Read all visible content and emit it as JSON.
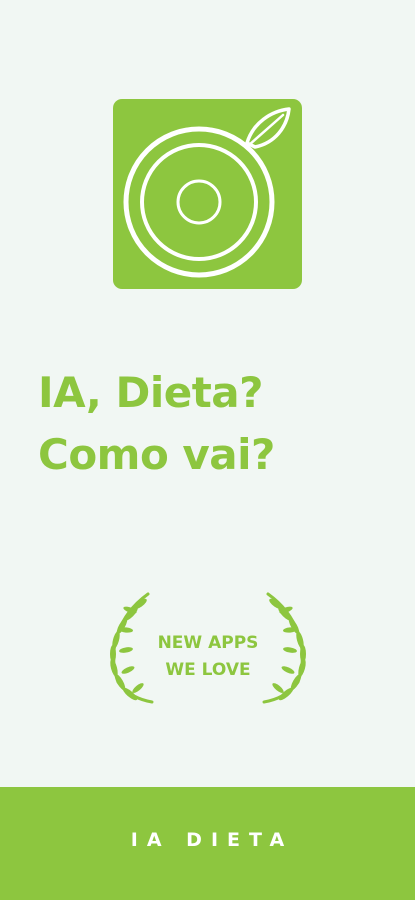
{
  "colors": {
    "brand_green": "#8dc63f",
    "background": "#f1f7f3",
    "footer_text": "#ffffff"
  },
  "logo": {
    "icon": "plate-with-leaf-icon"
  },
  "headline": {
    "line1": "IA, Dieta?",
    "line2": "Como vai?"
  },
  "award": {
    "line1": "NEW APPS",
    "line2": "WE LOVE",
    "icon": "laurel-wreath-icon"
  },
  "footer": {
    "app_name": "IA DIETA"
  }
}
